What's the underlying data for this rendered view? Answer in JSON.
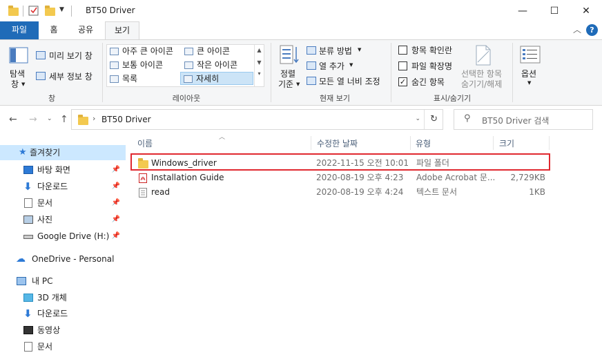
{
  "window": {
    "title": "BT50 Driver",
    "minimize_glyph": "—",
    "maximize_glyph": "☐",
    "close_glyph": "✕"
  },
  "tabs": [
    {
      "label": "파일"
    },
    {
      "label": "홈"
    },
    {
      "label": "공유"
    },
    {
      "label": "보기"
    }
  ],
  "ribbon": {
    "pane": {
      "nav_pane_line1": "탐색",
      "nav_pane_line2": "창",
      "preview": "미리 보기 창",
      "details": "세부 정보 창",
      "group": "창"
    },
    "layout": {
      "items": [
        "아주 큰 아이콘",
        "큰 아이콘",
        "보통 아이콘",
        "작은 아이콘",
        "목록",
        "자세히"
      ],
      "group": "레이아웃"
    },
    "current_view": {
      "sort_line1": "정렬",
      "sort_line2": "기준",
      "group_by": "분류 방법",
      "add_column": "열 추가",
      "fit_columns": "모든 열 너비 조정",
      "group": "현재 보기"
    },
    "show_hide": {
      "item_checkboxes": "항목 확인란",
      "file_extensions": "파일 확장명",
      "hidden_items": "숨긴 항목",
      "hide_selected_line1": "선택한 항목",
      "hide_selected_line2": "숨기기/해제",
      "group": "표시/숨기기",
      "checked": [
        "false",
        "false",
        "true"
      ]
    },
    "options": {
      "label": "옵션"
    }
  },
  "address": {
    "path": "BT50 Driver",
    "search_placeholder": "BT50 Driver 검색"
  },
  "navpane": {
    "quick_access": "즐겨찾기",
    "items": [
      "바탕 화면",
      "다운로드",
      "문서",
      "사진",
      "Google Drive (H:)"
    ],
    "onedrive": "OneDrive - Personal",
    "this_pc": "내 PC",
    "pc_items": [
      "3D 개체",
      "다운로드",
      "동영상",
      "문서"
    ]
  },
  "columns": {
    "name": "이름",
    "modified": "수정한 날짜",
    "type": "유형",
    "size": "크기"
  },
  "files": [
    {
      "name": "Windows_driver",
      "modified": "2022-11-15 오전 10:01",
      "type": "파일 폴더",
      "size": ""
    },
    {
      "name": "Installation Guide",
      "modified": "2020-08-19 오후 4:23",
      "type": "Adobe Acrobat 문...",
      "size": "2,729KB"
    },
    {
      "name": "read",
      "modified": "2020-08-19 오후 4:24",
      "type": "텍스트 문서",
      "size": "1KB"
    }
  ],
  "colors": {
    "accent": "#1f6bb8",
    "highlight": "#e0282f",
    "selection": "#cce8ff"
  }
}
